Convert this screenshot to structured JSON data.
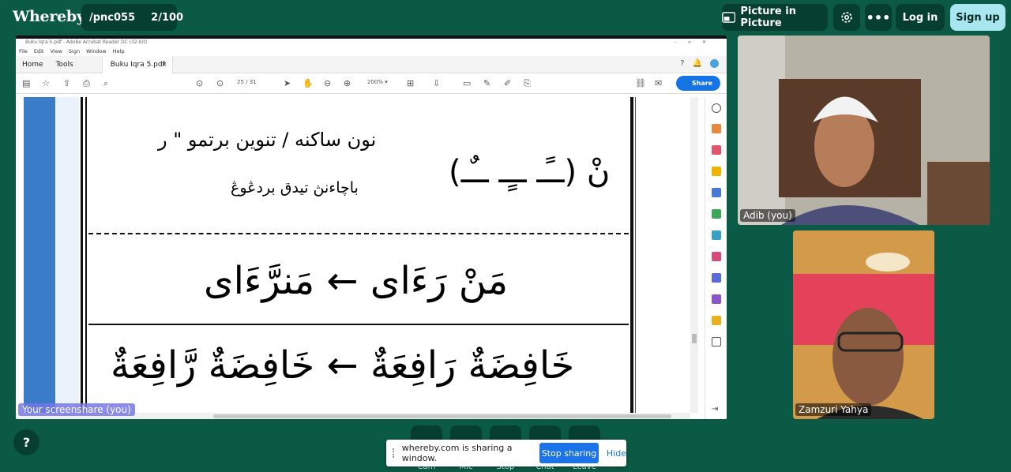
{
  "app": {
    "logo": "Whereby"
  },
  "room": {
    "name": "/pnc055",
    "count": "2/100"
  },
  "header": {
    "pip_label": "Picture in Picture",
    "login_label": "Log in",
    "signup_label": "Sign up"
  },
  "screenshare": {
    "label": "Your screenshare (you)",
    "acrobat": {
      "window_title": "Buku Iqra 5.pdf - Adobe Acrobat Reader DC (32-bit)",
      "menu": [
        "File",
        "Edit",
        "View",
        "Sign",
        "Window",
        "Help"
      ],
      "tabs": {
        "home": "Home",
        "tools": "Tools",
        "document": "Buku Iqra 5.pdf"
      },
      "page_current": "25",
      "page_total": "/ 31",
      "zoom": "200%",
      "share_label": "Share"
    },
    "pdf_text": {
      "line1": "نون ساكنه / تنوين برتمو \" ر",
      "line2": "باچاءنڽ تيدق بردڠوڠ",
      "symbols": "نْ (ــًـ ــٍـ ــٌـ)",
      "example1": "مَنْ رَءَاى ← مَنرَّءَاى",
      "example2": "خَافِضَةٌ رَافِعَةٌ ← خَافِضَةٌ رَّافِعَةٌ"
    }
  },
  "participants": [
    {
      "name": "Adib (you)"
    },
    {
      "name": "Zamzuri Yahya"
    }
  ],
  "controls": [
    {
      "label": "Cam"
    },
    {
      "label": "Mic"
    },
    {
      "label": "Stop"
    },
    {
      "label": "Chat"
    },
    {
      "label": "Leave"
    }
  ],
  "toast": {
    "message": "whereby.com is sharing a window.",
    "stop_label": "Stop sharing",
    "hide_label": "Hide"
  },
  "help_label": "?",
  "colors": {
    "background": "#0b5a46",
    "dark_button": "#063f31",
    "signup": "#a8e6f1",
    "share_blue": "#1473e6"
  }
}
